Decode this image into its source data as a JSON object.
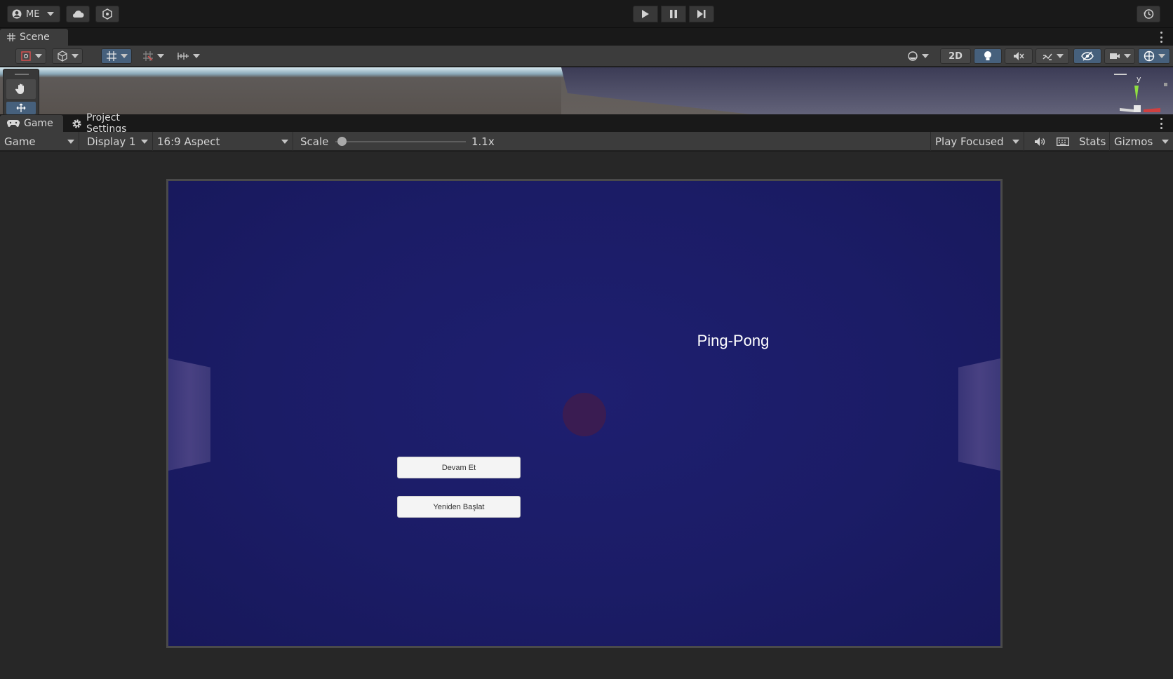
{
  "toolbar": {
    "account_label": "ME",
    "icons": [
      "account-icon",
      "cloud-icon",
      "collab-icon",
      "play-icon",
      "pause-icon",
      "step-icon",
      "history-icon"
    ]
  },
  "scene": {
    "tab_label": "Scene",
    "toolbar": {
      "mode_2d_label": "2D"
    }
  },
  "game": {
    "tab_label": "Game",
    "settings_tab_label": "Project Settings",
    "view_select": "Game",
    "display_select": "Display 1",
    "aspect_select": "16:9 Aspect",
    "scale_label": "Scale",
    "scale_value": "1.1x",
    "scale_fraction": 0.05,
    "play_mode_select": "Play Focused",
    "stats_label": "Stats",
    "gizmos_label": "Gizmos"
  },
  "game_view": {
    "title": "Ping-Pong",
    "continue_button": "Devam Et",
    "restart_button": "Yeniden Başlat",
    "background_color": "#1e1f70",
    "ball_color": "#3a1c52"
  },
  "gizmo": {
    "axis_label": "y"
  },
  "colors": {
    "accent_blue": "#46607c",
    "panel": "#3c3c3c",
    "dark": "#191919"
  }
}
